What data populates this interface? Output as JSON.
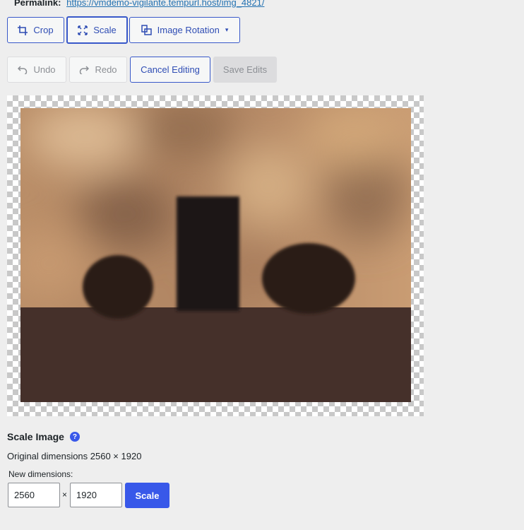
{
  "permalink": {
    "label": "Permalink:",
    "url": "https://vmdemo-vigilante.tempurl.host/img_4821/"
  },
  "toolbar": {
    "crop": "Crop",
    "scale": "Scale",
    "rotation": "Image Rotation",
    "rotation_caret": "▾"
  },
  "history": {
    "undo": "Undo",
    "redo": "Redo",
    "cancel": "Cancel Editing",
    "save": "Save Edits"
  },
  "scale_panel": {
    "title": "Scale Image",
    "help": "?",
    "original": "Original dimensions 2560 × 1920",
    "new_label": "New dimensions:",
    "width_value": "2560",
    "separator": "×",
    "height_value": "1920",
    "submit": "Scale"
  },
  "colors": {
    "accent": "#3858e9",
    "link": "#2271b1",
    "background": "#eeeeee"
  },
  "icons": [
    "crop-icon",
    "scale-icon",
    "rotation-icon",
    "undo-icon",
    "redo-icon",
    "help-icon"
  ]
}
